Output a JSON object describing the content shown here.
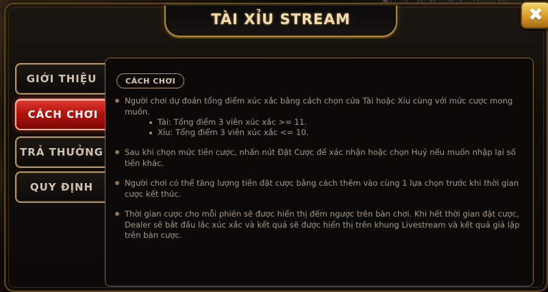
{
  "background": {
    "top_text": "Cảc siêu đội đã xuất rồng Vương liên",
    "speaker_icon": "speaker-icon"
  },
  "dialog": {
    "title": "TÀI XỈU STREAM",
    "close_label": "✖"
  },
  "tabs": [
    {
      "label": "GIỚI THIỆU",
      "active": false
    },
    {
      "label": "CÁCH CHƠI",
      "active": true
    },
    {
      "label": "TRẢ THƯỞNG",
      "active": false
    },
    {
      "label": "QUY ĐỊNH",
      "active": false
    }
  ],
  "content": {
    "section_label": "CÁCH CHƠI",
    "items": [
      {
        "text": "Người chơi dự đoán tổng điểm xúc xắc bằng cách chọn cửa Tài hoặc Xỉu cùng với mức cược mong muốn.",
        "sub": [
          "Tài: Tổng điểm 3 viên xúc xắc >= 11.",
          "Xỉu: Tổng điểm 3 viên xúc xắc <= 10."
        ]
      },
      {
        "text": "Sau khi chọn mức tiền cược, nhấn nút Đặt Cược để xác nhận hoặc chọn Huỷ nếu muốn nhập lại số tiền khác."
      },
      {
        "text": "Người chơi có thể tăng lượng tiền đặt cược bằng cách thêm vào cùng 1 lựa chọn trước khi thời gian cược kết thúc."
      },
      {
        "text": "Thời gian cược cho mỗi phiên sẽ được hiển thị đếm ngược trên bàn chơi. Khi hết thời gian đặt cược, Dealer sẽ bắt đầu lắc xúc xắc và kết quả sẽ được hiển thị trên khung Livestream và kết quả giả lập trên bàn cược."
      }
    ]
  },
  "colors": {
    "accent_gold": "#b28a3e",
    "active_tab_red": "#b3150e",
    "close_gold": "#d89b2a"
  }
}
